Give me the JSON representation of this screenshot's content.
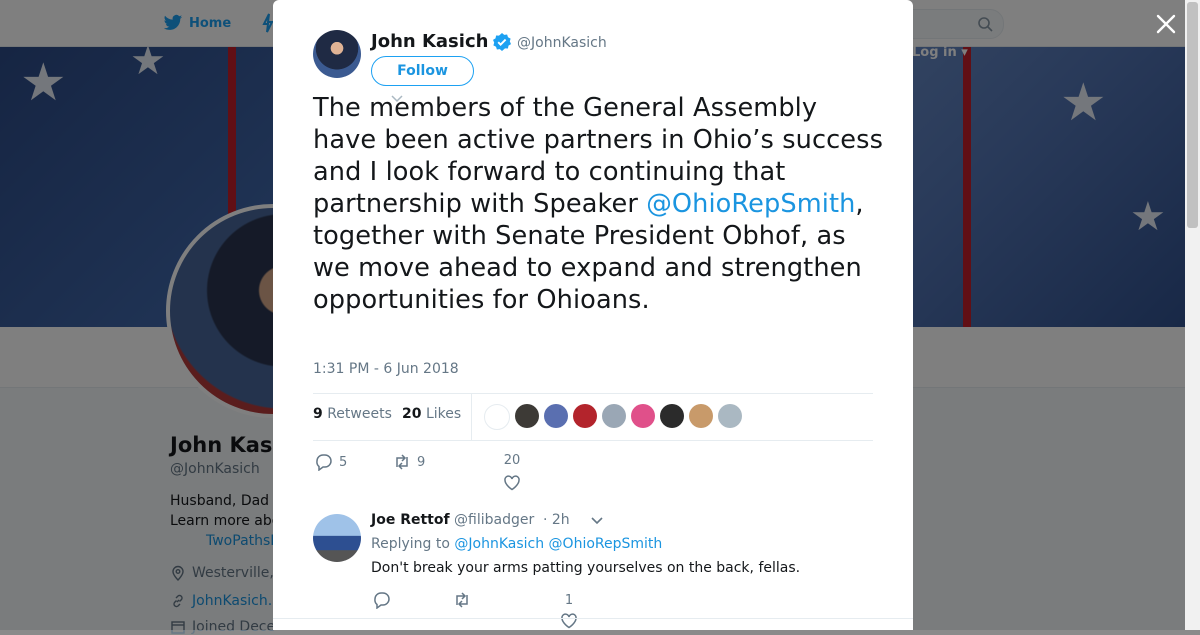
{
  "background": {
    "nav": {
      "home_label": "Home",
      "login_label": "Log in"
    },
    "profile": {
      "name": "John Kas",
      "handle": "@JohnKasich",
      "bio_line1": "Husband, Dad",
      "bio_line2": "Learn more abo",
      "bio_link": "TwoPathsB",
      "location": "Westerville,",
      "website": "JohnKasich.",
      "joined": "Joined Dece"
    }
  },
  "tweet": {
    "author_name": "John Kasich",
    "author_handle": "@JohnKasich",
    "follow_label": "Follow",
    "text_before": "The members of the General Assembly have been active partners in Ohio’s success and I look forward to continuing that partnership with Speaker ",
    "text_mention": "@OhioRepSmith",
    "text_after": ", together with Senate President Obhof, as we move ahead to expand and strengthen opportunities for Ohioans.",
    "timestamp": "1:31 PM - 6 Jun 2018",
    "retweet_count": "9",
    "retweet_label": "Retweets",
    "like_count": "20",
    "like_label": "Likes",
    "likers": [
      {
        "icon": "texans-avatar",
        "color": "#ffffff"
      },
      {
        "icon": "person-avatar",
        "color": "#3d3a36"
      },
      {
        "icon": "person-avatar",
        "color": "#5a6fb0"
      },
      {
        "icon": "person-avatar",
        "color": "#b3242c"
      },
      {
        "icon": "person-avatar",
        "color": "#9aa7b5"
      },
      {
        "icon": "person-avatar",
        "color": "#e0508a"
      },
      {
        "icon": "person-avatar",
        "color": "#2b2b2b"
      },
      {
        "icon": "person-avatar",
        "color": "#c89a6a"
      },
      {
        "icon": "default-avatar",
        "color": "#aab8c2"
      }
    ],
    "actions": {
      "reply_count": "5",
      "retweet_count": "9",
      "like_count": "20"
    }
  },
  "reply": {
    "author_name": "Joe Rettof",
    "author_handle": "@filibadger",
    "time": "· 2h",
    "replying_prefix": "Replying to ",
    "replying_mentions": "@JohnKasich @OhioRepSmith",
    "text": "Don't break your arms patting yourselves on the back, fellas.",
    "actions": {
      "reply_count": "",
      "retweet_count": "",
      "like_count": "1"
    }
  },
  "colors": {
    "accent": "#1b95e0",
    "text": "#14171a",
    "muted": "#657786"
  }
}
